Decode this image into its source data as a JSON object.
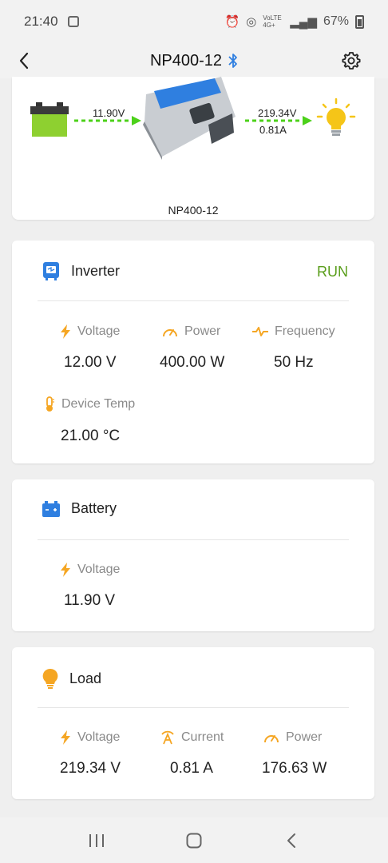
{
  "status_bar": {
    "time": "21:40",
    "battery_percent": "67%",
    "network": "VoLTE 4G+"
  },
  "header": {
    "title": "NP400-12",
    "bluetooth_icon": "bluetooth-icon"
  },
  "diagram": {
    "input_voltage": "11.90V",
    "output_voltage": "219.34V",
    "output_current": "0.81A",
    "device_name": "NP400-12"
  },
  "inverter": {
    "title": "Inverter",
    "status": "RUN",
    "status_color": "#5a9e1c",
    "metrics": [
      {
        "label": "Voltage",
        "value": "12.00 V",
        "icon": "bolt-icon"
      },
      {
        "label": "Power",
        "value": "400.00 W",
        "icon": "gauge-icon"
      },
      {
        "label": "Frequency",
        "value": "50 Hz",
        "icon": "pulse-icon"
      },
      {
        "label": "Device Temp",
        "value": "21.00 °C",
        "icon": "thermometer-icon"
      }
    ]
  },
  "battery": {
    "title": "Battery",
    "metrics": [
      {
        "label": "Voltage",
        "value": "11.90 V",
        "icon": "bolt-icon"
      }
    ]
  },
  "load": {
    "title": "Load",
    "metrics": [
      {
        "label": "Voltage",
        "value": "219.34 V",
        "icon": "bolt-icon"
      },
      {
        "label": "Current",
        "value": "0.81 A",
        "icon": "current-icon"
      },
      {
        "label": "Power",
        "value": "176.63 W",
        "icon": "gauge-icon"
      }
    ]
  },
  "colors": {
    "accent_orange": "#f5a623",
    "accent_blue": "#2f7fe0",
    "flow_green": "#4cd11a"
  }
}
